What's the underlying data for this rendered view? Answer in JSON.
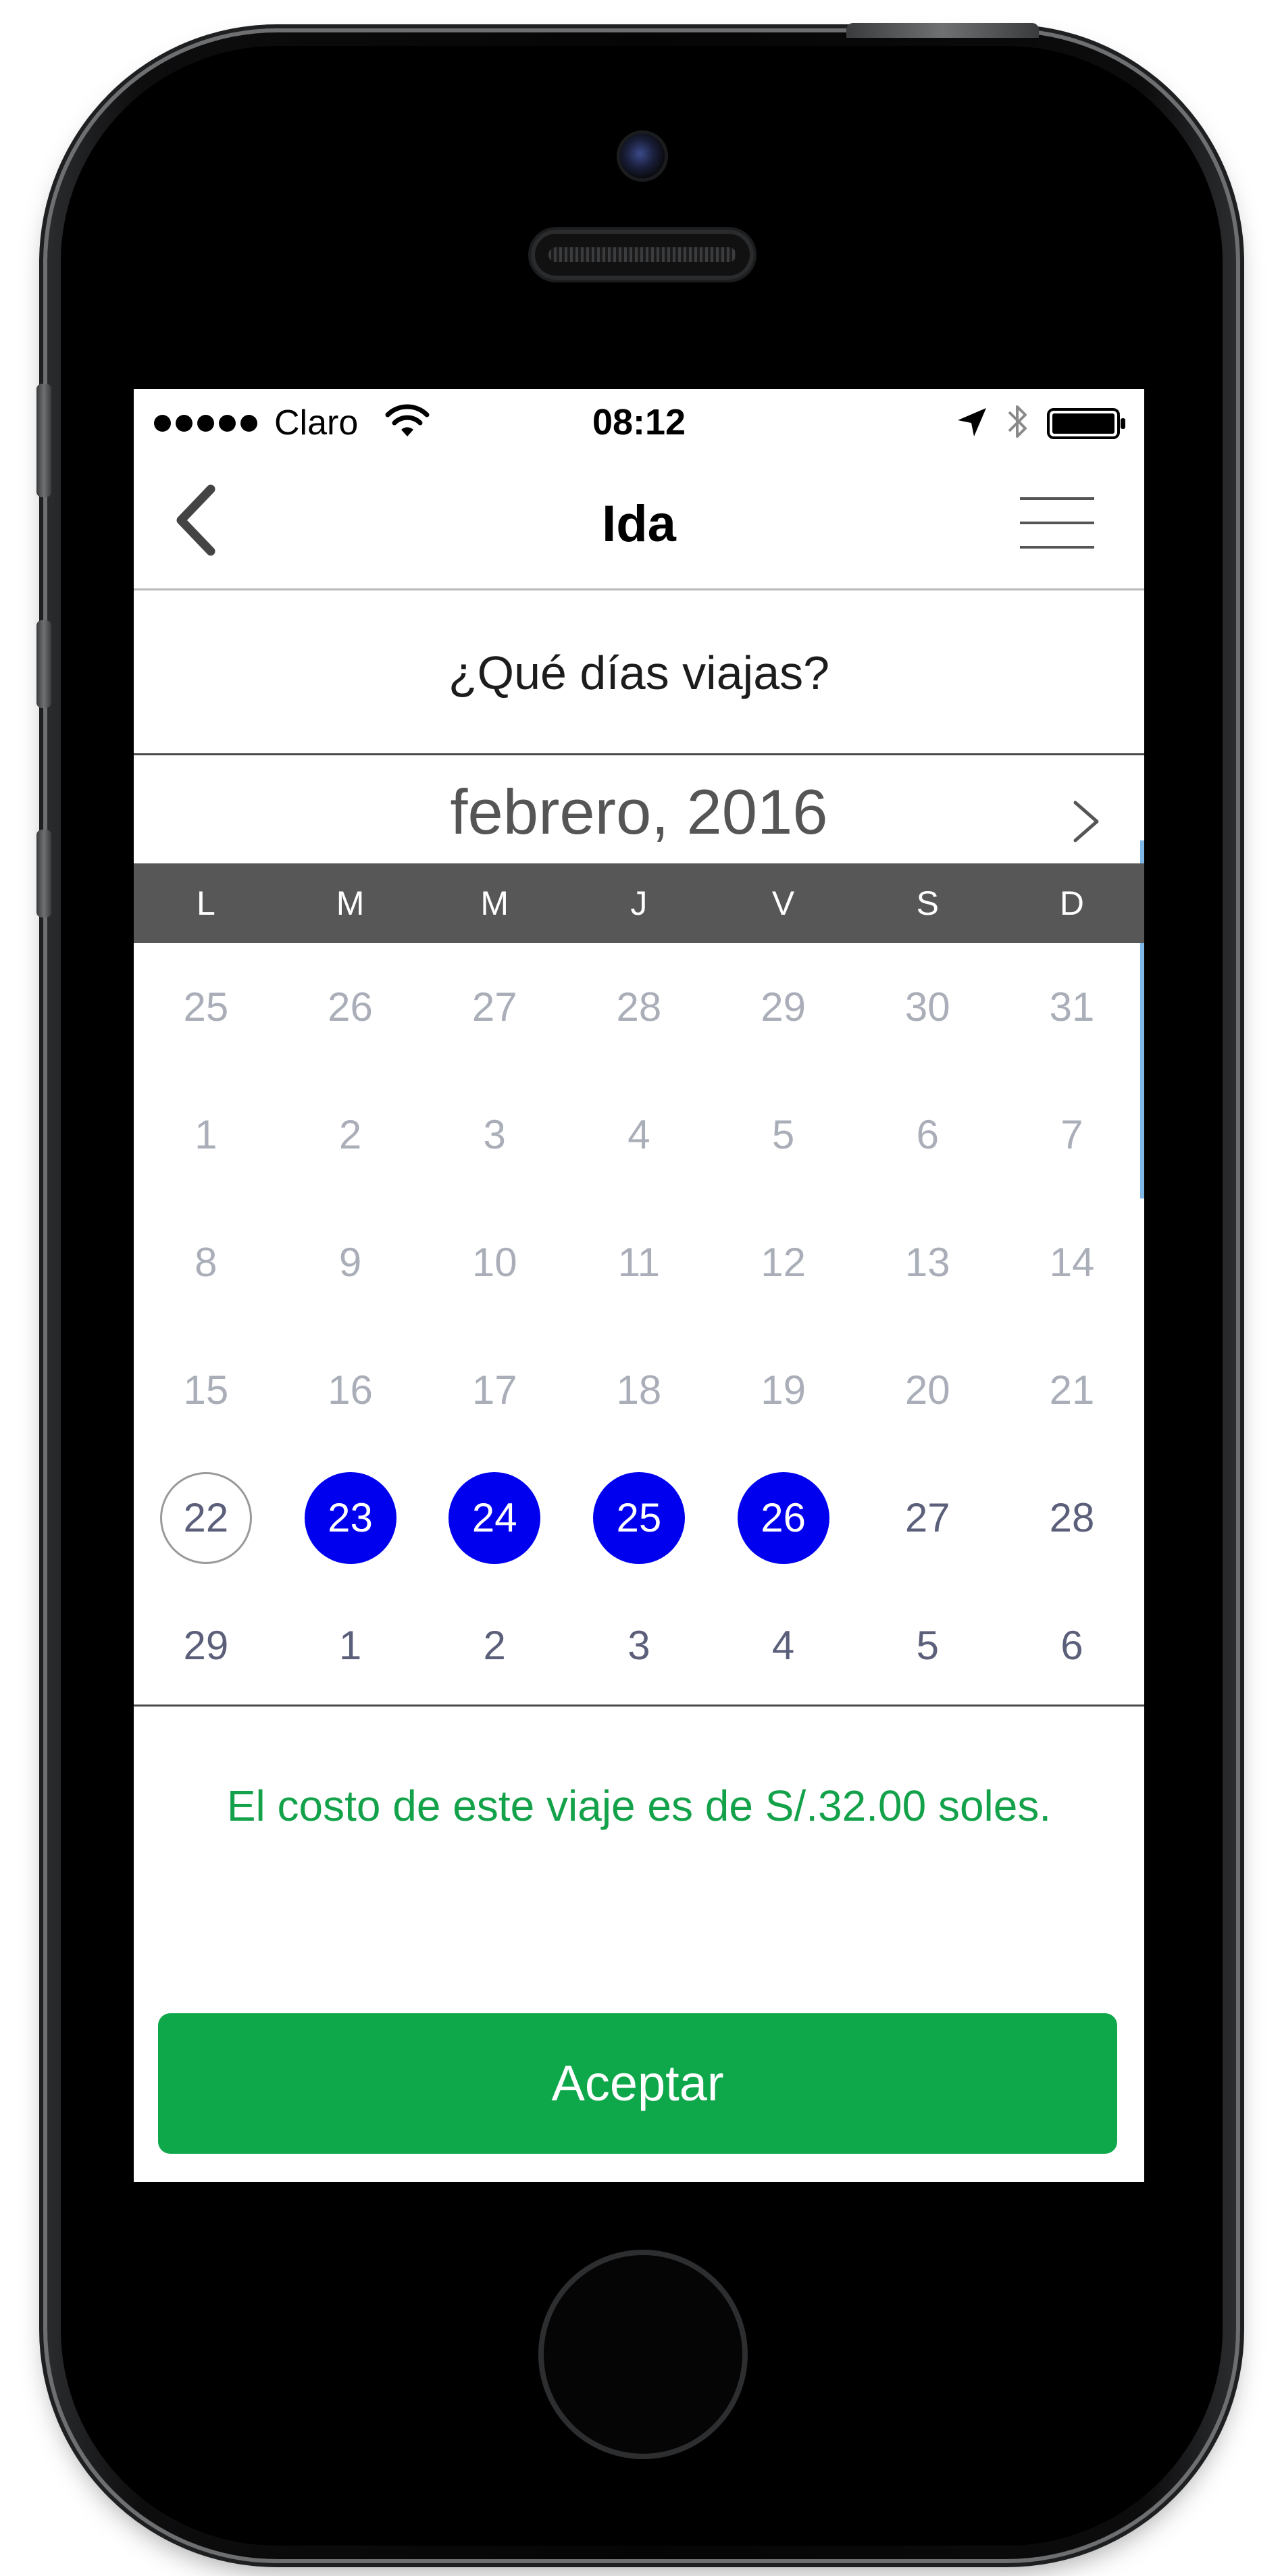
{
  "status_bar": {
    "carrier": "Claro",
    "time": "08:12",
    "signal_bars": 5,
    "icons": [
      "wifi-icon",
      "location-arrow-icon",
      "bluetooth-icon",
      "battery-icon"
    ]
  },
  "nav": {
    "title": "Ida",
    "back_icon": "chevron-left-icon",
    "menu_icon": "hamburger-menu-icon"
  },
  "question": "¿Qué días viajas?",
  "calendar": {
    "month_label": "febrero, 2016",
    "next_icon": "chevron-right-icon",
    "weekdays": [
      "L",
      "M",
      "M",
      "J",
      "V",
      "S",
      "D"
    ],
    "weeks": [
      [
        {
          "d": "25",
          "s": "inactive"
        },
        {
          "d": "26",
          "s": "inactive"
        },
        {
          "d": "27",
          "s": "inactive"
        },
        {
          "d": "28",
          "s": "inactive"
        },
        {
          "d": "29",
          "s": "inactive"
        },
        {
          "d": "30",
          "s": "inactive"
        },
        {
          "d": "31",
          "s": "inactive"
        }
      ],
      [
        {
          "d": "1",
          "s": "inactive"
        },
        {
          "d": "2",
          "s": "inactive"
        },
        {
          "d": "3",
          "s": "inactive"
        },
        {
          "d": "4",
          "s": "inactive"
        },
        {
          "d": "5",
          "s": "inactive"
        },
        {
          "d": "6",
          "s": "inactive"
        },
        {
          "d": "7",
          "s": "inactive"
        }
      ],
      [
        {
          "d": "8",
          "s": "inactive"
        },
        {
          "d": "9",
          "s": "inactive"
        },
        {
          "d": "10",
          "s": "inactive"
        },
        {
          "d": "11",
          "s": "inactive"
        },
        {
          "d": "12",
          "s": "inactive"
        },
        {
          "d": "13",
          "s": "inactive"
        },
        {
          "d": "14",
          "s": "inactive"
        }
      ],
      [
        {
          "d": "15",
          "s": "inactive"
        },
        {
          "d": "16",
          "s": "inactive"
        },
        {
          "d": "17",
          "s": "inactive"
        },
        {
          "d": "18",
          "s": "inactive"
        },
        {
          "d": "19",
          "s": "inactive"
        },
        {
          "d": "20",
          "s": "inactive"
        },
        {
          "d": "21",
          "s": "inactive"
        }
      ],
      [
        {
          "d": "22",
          "s": "today"
        },
        {
          "d": "23",
          "s": "selected"
        },
        {
          "d": "24",
          "s": "selected"
        },
        {
          "d": "25",
          "s": "selected"
        },
        {
          "d": "26",
          "s": "selected"
        },
        {
          "d": "27",
          "s": "available"
        },
        {
          "d": "28",
          "s": "available"
        }
      ],
      [
        {
          "d": "29",
          "s": "available"
        },
        {
          "d": "1",
          "s": "available"
        },
        {
          "d": "2",
          "s": "available"
        },
        {
          "d": "3",
          "s": "available"
        },
        {
          "d": "4",
          "s": "available"
        },
        {
          "d": "5",
          "s": "available"
        },
        {
          "d": "6",
          "s": "available"
        }
      ]
    ]
  },
  "cost_message": "El costo de este viaje es de S/.32.00 soles.",
  "accept_label": "Aceptar",
  "colors": {
    "selected_day": "#0000ee",
    "accent_green": "#0ea84b",
    "cost_text": "#13a24a",
    "weekday_bar": "#575757"
  }
}
